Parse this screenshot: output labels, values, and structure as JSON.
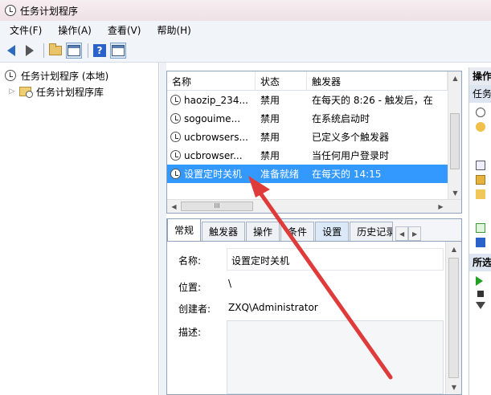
{
  "window": {
    "title": "任务计划程序"
  },
  "menu": {
    "items": [
      "文件(F)",
      "操作(A)",
      "查看(V)",
      "帮助(H)"
    ]
  },
  "tree": {
    "items": [
      {
        "label": "任务计划程序 (本地)"
      },
      {
        "label": "任务计划程序库"
      }
    ]
  },
  "tasklist": {
    "columns": [
      "名称",
      "状态",
      "触发器"
    ],
    "rows": [
      {
        "name": "haozip_234...",
        "status": "禁用",
        "trigger": "在每天的 8:26 - 触发后，在"
      },
      {
        "name": "sogouime...",
        "status": "禁用",
        "trigger": "在系统启动时"
      },
      {
        "name": "ucbrowsers...",
        "status": "禁用",
        "trigger": "已定义多个触发器"
      },
      {
        "name": "ucbrowser...",
        "status": "禁用",
        "trigger": "当任何用户登录时"
      },
      {
        "name": "设置定时关机",
        "status": "准备就绪",
        "trigger": "在每天的 14:15"
      }
    ],
    "hscroll_grip": "III"
  },
  "detail": {
    "tabs": [
      "常规",
      "触发器",
      "操作",
      "条件",
      "设置",
      "历史记录"
    ],
    "fields": {
      "name_label": "名称:",
      "name_value": "设置定时关机",
      "location_label": "位置:",
      "location_value": "\\",
      "author_label": "创建者:",
      "author_value": "ZXQ\\Administrator",
      "desc_label": "描述:"
    }
  },
  "actions": {
    "header": "操作",
    "sub1": "任务",
    "sub2": "所选"
  },
  "colors": {
    "selection": "#3399ff",
    "annotation": "#e03b3b"
  }
}
